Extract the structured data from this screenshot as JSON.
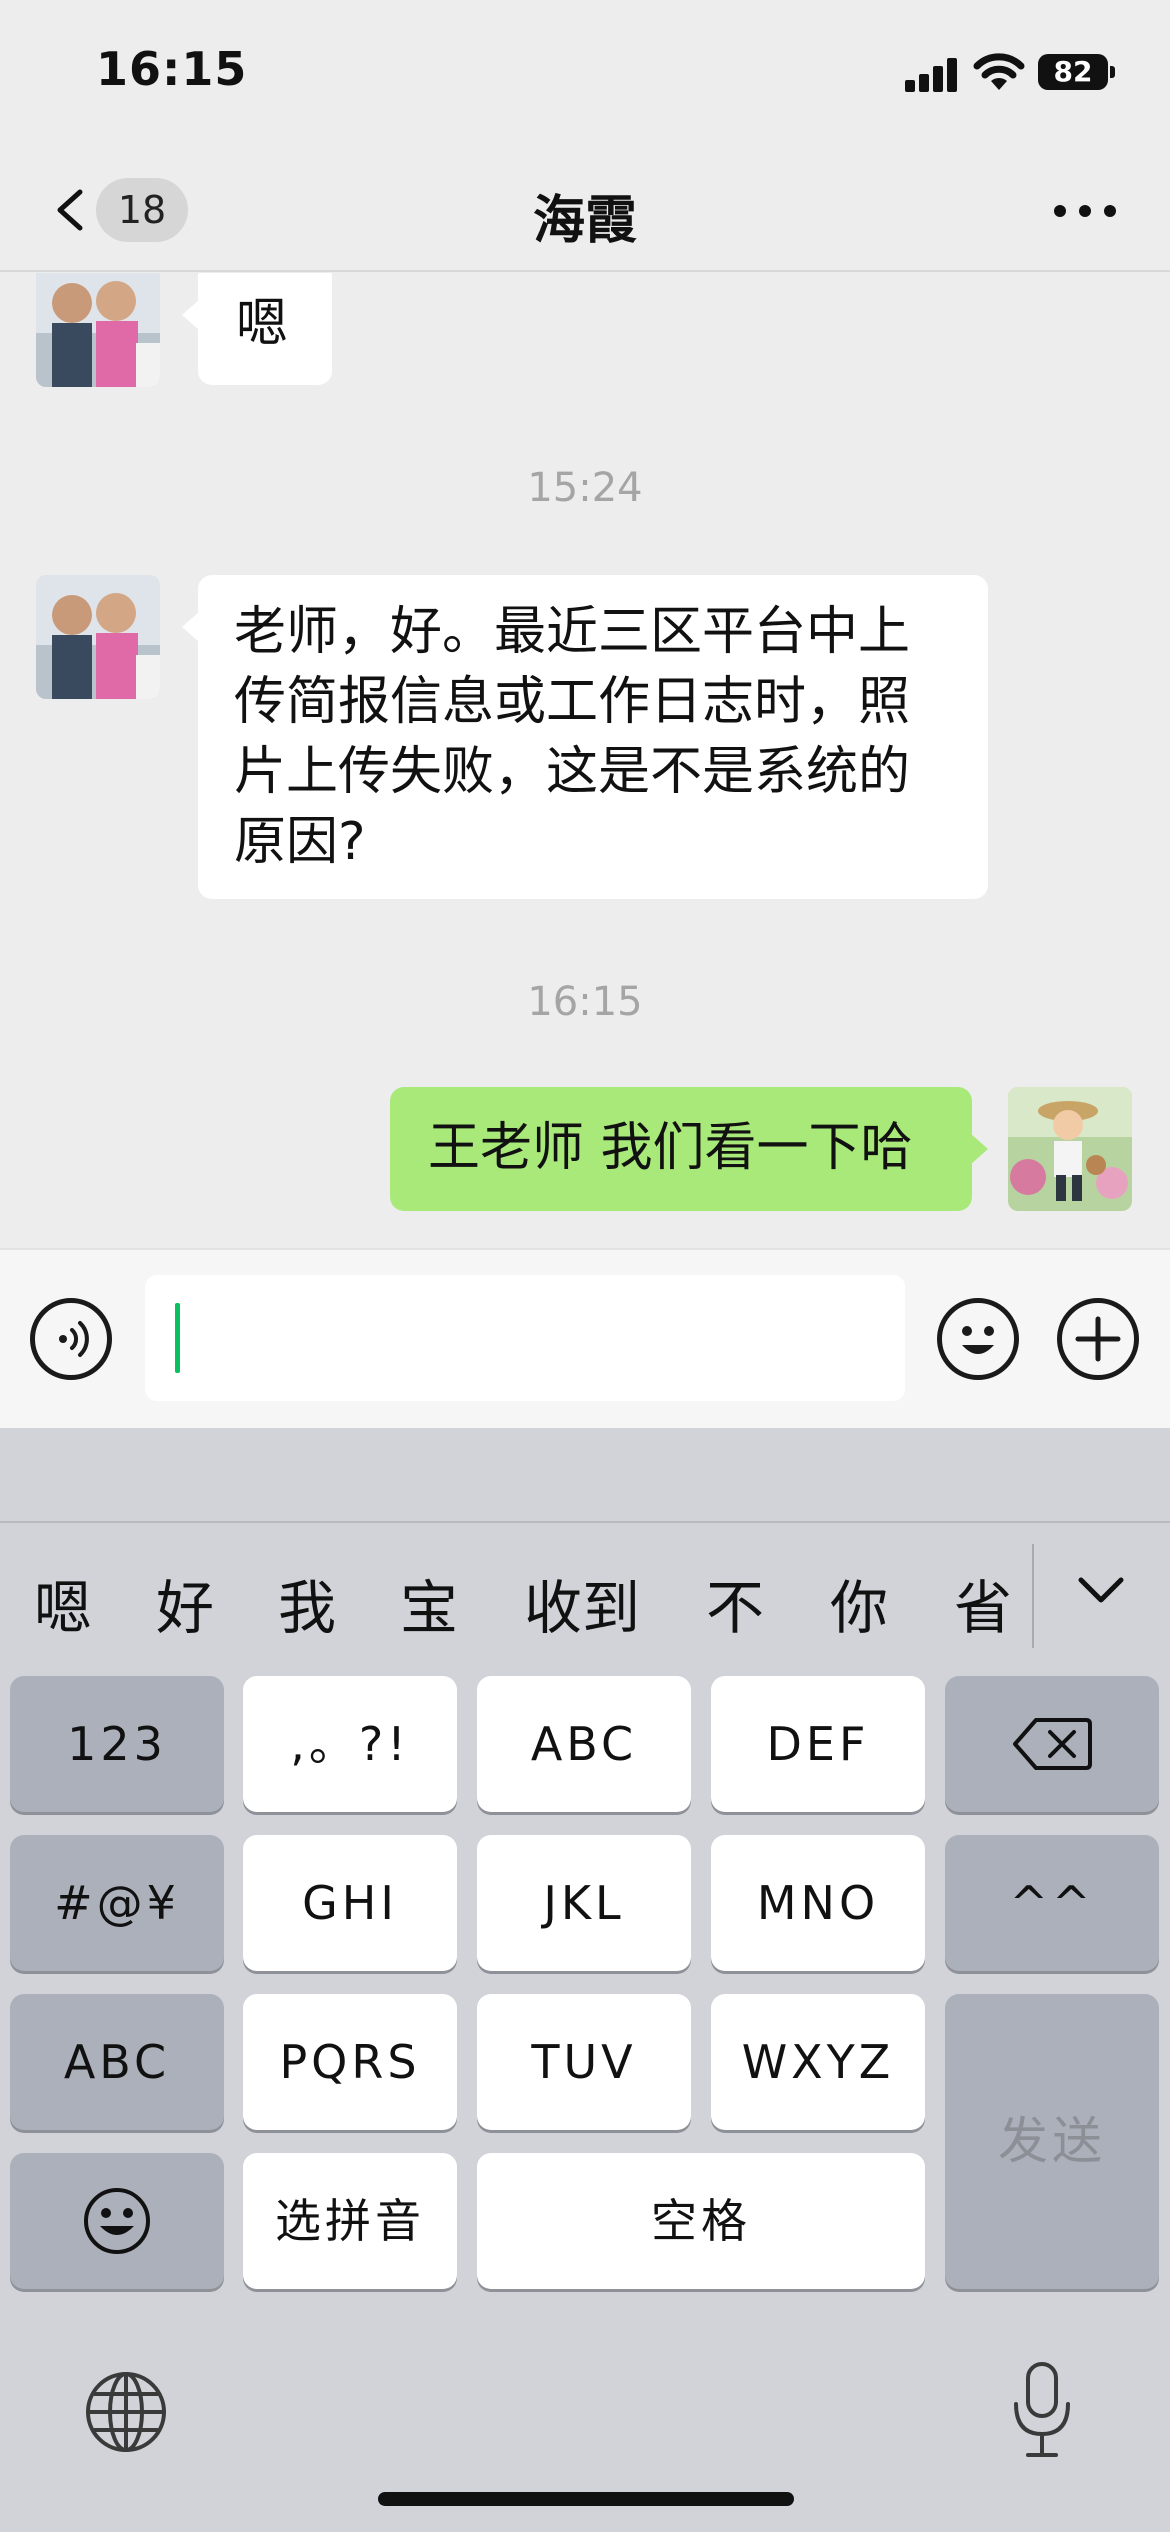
{
  "status_bar": {
    "time": "16:15",
    "battery": "82"
  },
  "nav": {
    "back_count": "18",
    "title": "海霞"
  },
  "messages": {
    "m1": {
      "sender": "contact",
      "text": "嗯"
    },
    "t1": "15:24",
    "m2": {
      "sender": "contact",
      "lines": [
        "老师，好。最近三区平台中上",
        "传简报信息或工作日志时，照",
        "片上传失败，这是不是系统的",
        "原因?"
      ]
    },
    "t2": "16:15",
    "m3": {
      "sender": "me",
      "text": "王老师 我们看一下哈"
    }
  },
  "input": {
    "value": ""
  },
  "keyboard": {
    "suggestions": [
      "嗯",
      "好",
      "我",
      "宝",
      "收到",
      "不",
      "你",
      "省"
    ],
    "row1": [
      "123",
      ",。?!",
      "ABC",
      "DEF"
    ],
    "row2": [
      "#@¥",
      "GHI",
      "JKL",
      "MNO",
      "^^"
    ],
    "row3": [
      "ABC",
      "PQRS",
      "TUV",
      "WXYZ"
    ],
    "row4": {
      "pinyin": "选拼音",
      "space": "空格"
    },
    "send": "发送"
  },
  "colors": {
    "my_bubble": "#a9e97a",
    "caret": "#07c160",
    "background": "#ededed"
  }
}
